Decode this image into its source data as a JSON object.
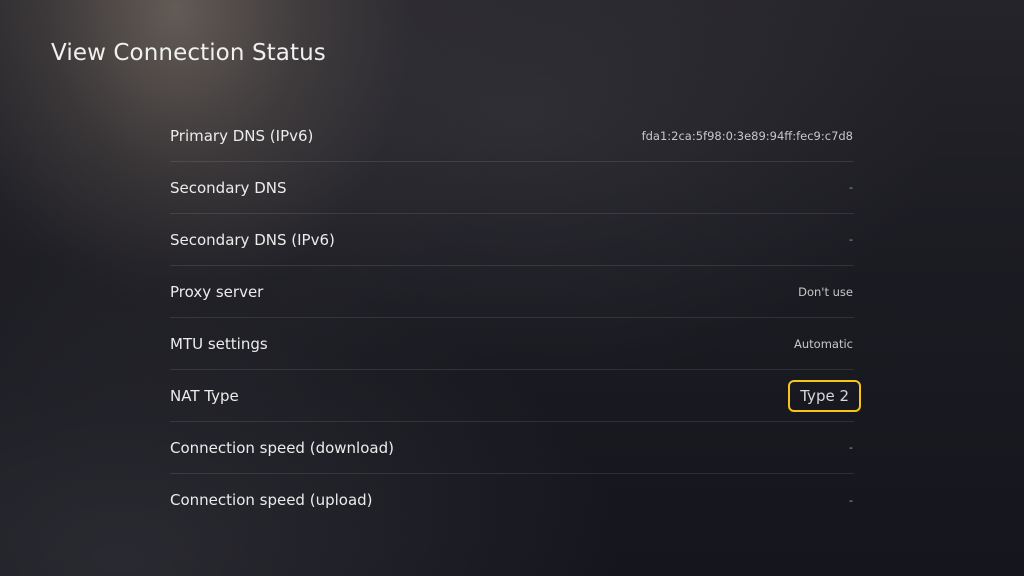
{
  "header": {
    "title": "View Connection Status"
  },
  "rows": [
    {
      "label": "Primary DNS (IPv6)",
      "value": "fda1:2ca:5f98:0:3e89:94ff:fec9:c7d8"
    },
    {
      "label": "Secondary DNS",
      "value": "-"
    },
    {
      "label": "Secondary DNS (IPv6)",
      "value": "-"
    },
    {
      "label": "Proxy server",
      "value": "Don't use"
    },
    {
      "label": "MTU settings",
      "value": "Automatic"
    },
    {
      "label": "NAT Type",
      "value": "Type 2"
    },
    {
      "label": "Connection speed (download)",
      "value": "-"
    },
    {
      "label": "Connection speed (upload)",
      "value": "-"
    }
  ],
  "colors": {
    "highlight": "#f5c518"
  }
}
